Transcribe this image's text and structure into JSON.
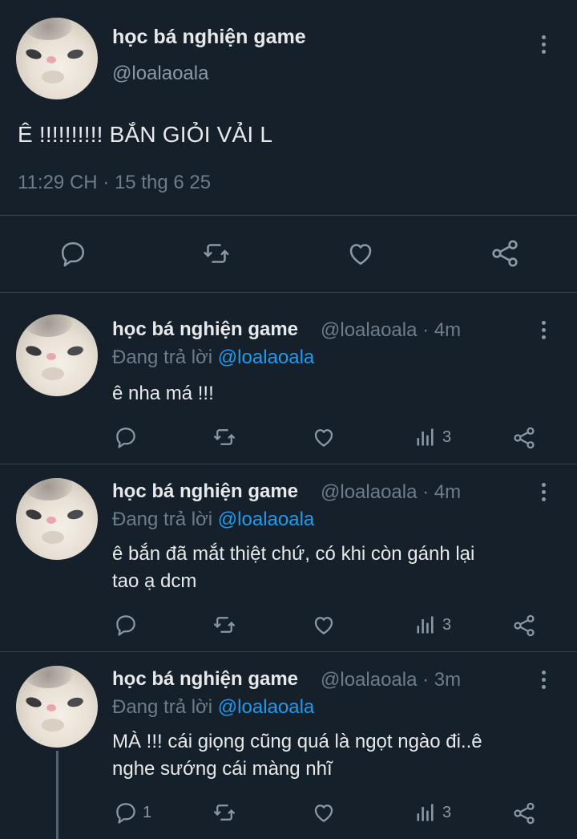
{
  "main_tweet": {
    "display_name": "học bá nghiện game",
    "handle": "@loalaoala",
    "text": "Ê !!!!!!!!!! BẮN GIỎI VẢI L",
    "timestamp": "11:29 CH · 15 thg 6 25",
    "actions": [
      "reply-icon",
      "retweet-icon",
      "like-icon",
      "share-icon"
    ]
  },
  "replies": [
    {
      "display_name": "học bá nghiện game",
      "handle_time": "@loalaoala · 4m",
      "replying_prefix": "Đang trả lời ",
      "replying_to": "@loalaoala",
      "text": "ê nha má !!!",
      "reply_count": "",
      "views": "3"
    },
    {
      "display_name": "học bá nghiện game",
      "handle_time": "@loalaoala · 4m",
      "replying_prefix": "Đang trả lời ",
      "replying_to": "@loalaoala",
      "text_line1": "ê bắn đã mắt thiệt chứ, có khi còn gánh lại",
      "text_line2": "tao ạ dcm",
      "reply_count": "",
      "views": "3"
    },
    {
      "display_name": "học bá nghiện game",
      "handle_time": "@loalaoala · 3m",
      "replying_prefix": "Đang trả lời ",
      "replying_to": "@loalaoala",
      "text_line1": "MÀ !!! cái giọng cũng quá là ngọt ngào đi..ê",
      "text_line2": "nghe sướng cái màng nhĩ",
      "reply_count": "1",
      "views": "3"
    }
  ],
  "colors": {
    "background": "#15202b",
    "text": "#e7e9ea",
    "muted": "#8b98a5",
    "mention": "#1d9bf0",
    "divider": "#38444d"
  }
}
